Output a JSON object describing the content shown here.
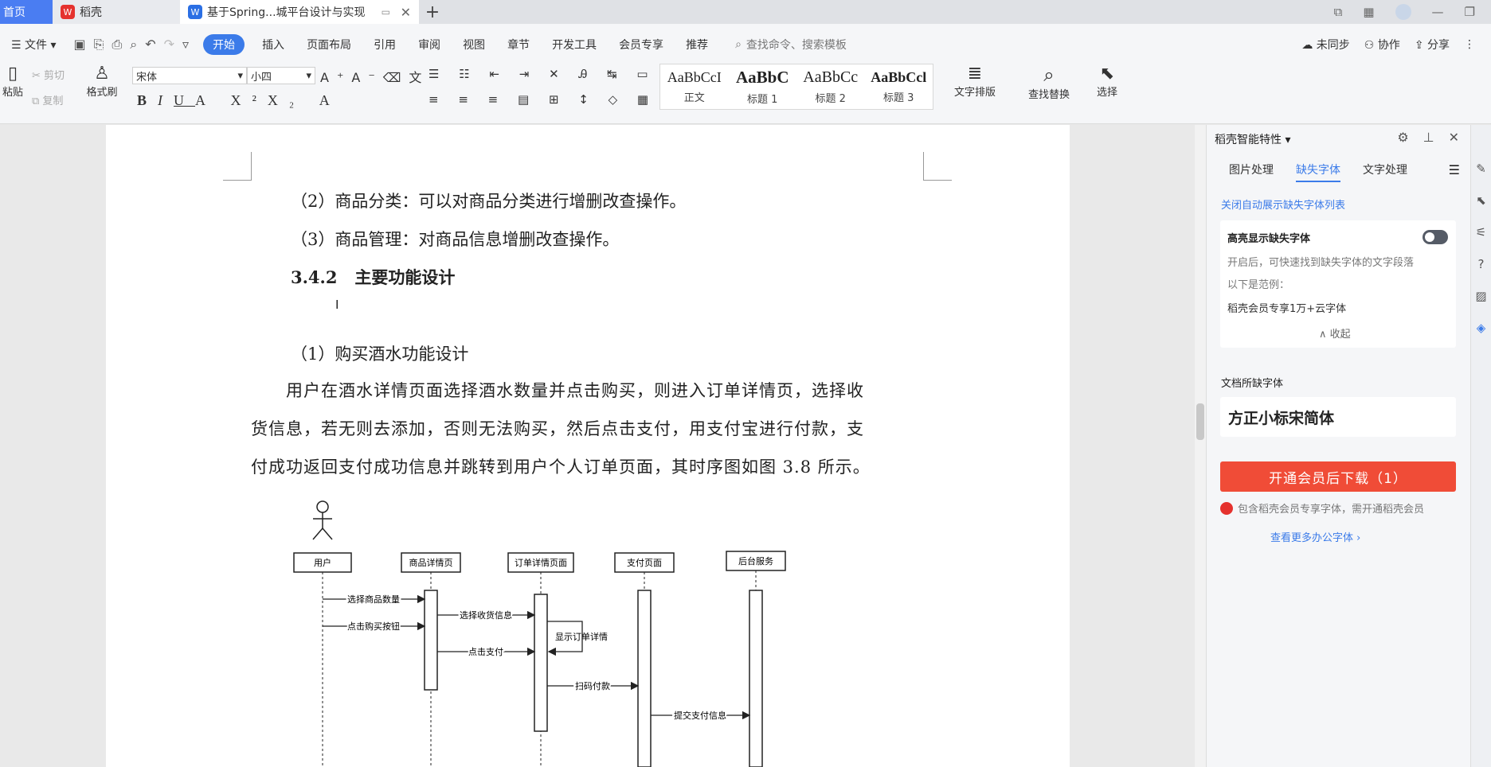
{
  "tabs": {
    "home": "首页",
    "dao": "稻壳",
    "doc": "基于Spring...城平台设计与实现"
  },
  "menu": {
    "file": "文件",
    "items": [
      "开始",
      "插入",
      "页面布局",
      "引用",
      "审阅",
      "视图",
      "章节",
      "开发工具",
      "会员专享",
      "推荐"
    ],
    "search": "查找命令、搜索模板",
    "unsynced": "未同步",
    "collab": "协作",
    "share": "分享"
  },
  "ribbon": {
    "paste": "粘贴",
    "cut": "剪切",
    "copy": "复制",
    "format_painter": "格式刷",
    "font": "宋体",
    "size": "小四",
    "styles": [
      {
        "sample": "AaBbCcI",
        "name": "正文"
      },
      {
        "sample": "AaBbC",
        "name": "标题 1"
      },
      {
        "sample": "AaBbCc",
        "name": "标题 2"
      },
      {
        "sample": "AaBbCcl",
        "name": "标题 3"
      }
    ],
    "text_layout": "文字排版",
    "find_replace": "查找替换",
    "select": "选择"
  },
  "document": {
    "line1": "（2）商品分类：可以对商品分类进行增删改查操作。",
    "line2": "（3）商品管理：对商品信息增删改查操作。",
    "heading_num": "3.4.2",
    "heading_text": "主要功能设计",
    "sub": "（1）购买酒水功能设计",
    "body": [
      "用户在酒水详情页面选择酒水数量并点击购买，则进入订单详情页，选择收",
      "货信息，若无则去添加，否则无法购买，然后点击支付，用支付宝进行付款，支",
      "付成功返回支付成功信息并跳转到用户个人订单页面，其时序图如图 3.8 所示。"
    ],
    "diagram": {
      "actors": [
        "用户",
        "商品详情页",
        "订单详情页面",
        "支付页面",
        "后台服务"
      ],
      "messages": [
        "选择商品数量",
        "点击购买按钮",
        "选择收货信息",
        "显示订单详情",
        "点击支付",
        "扫码付款",
        "提交支付信息"
      ]
    }
  },
  "panel": {
    "title": "稻壳智能特性",
    "tabs": [
      "图片处理",
      "缺失字体",
      "文字处理"
    ],
    "close_auto": "关闭自动展示缺失字体列表",
    "highlight": "高亮显示缺失字体",
    "desc": "开启后，可快速找到缺失字体的文字段落",
    "example_label": "以下是范例：",
    "example": "稻壳会员专享1万+云字体",
    "collapse": "收起",
    "missing_label": "文档所缺字体",
    "missing_font": "方正小标宋简体",
    "download": "开通会员后下载（1）",
    "note": "包含稻壳会员专享字体，需开通稻壳会员",
    "more": "查看更多办公字体"
  },
  "colors": {
    "accent": "#3b7be9",
    "red": "#f04c37"
  }
}
